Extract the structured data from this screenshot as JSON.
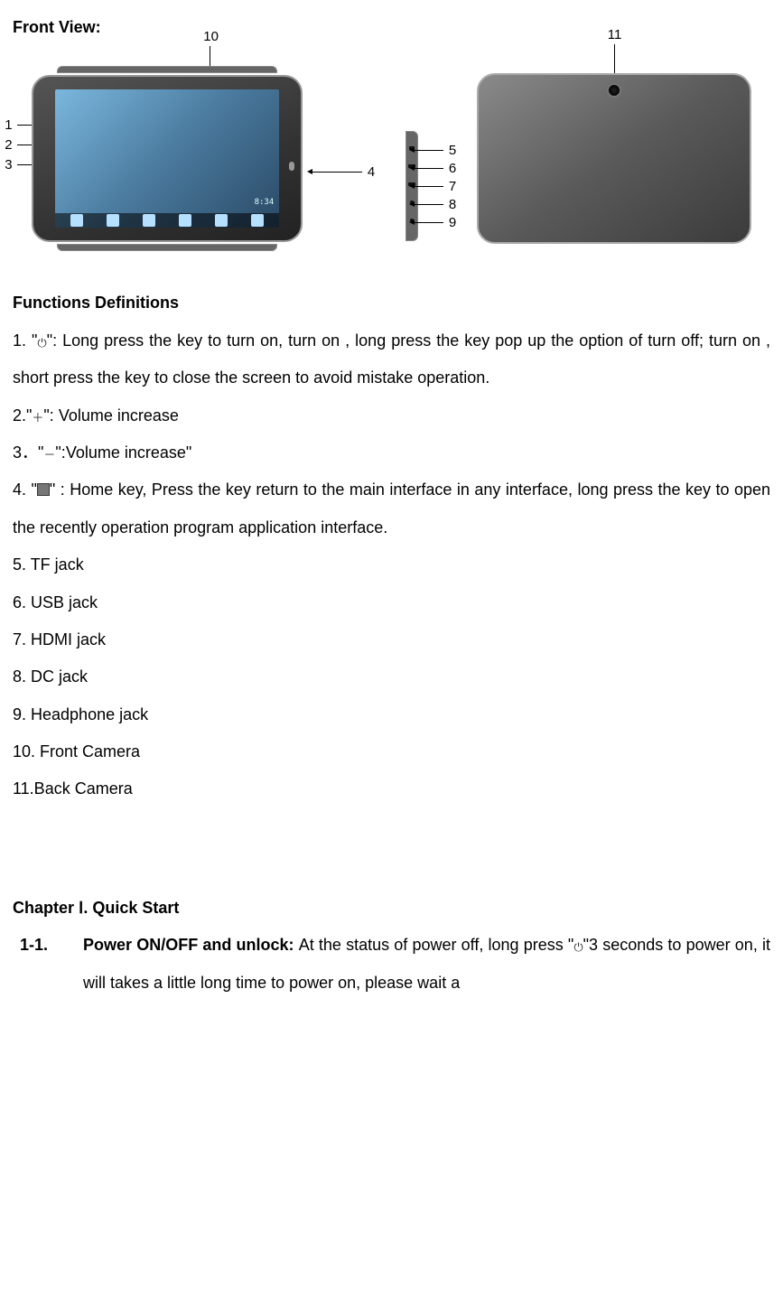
{
  "title": "Front View:",
  "diagram": {
    "front": {
      "leftCallouts": [
        "1",
        "2",
        "3"
      ],
      "rightCallout": "4",
      "topCallout": "10",
      "screenClock": "8:34",
      "topRightCallouts": [
        "5",
        "6",
        "7",
        "8",
        "9"
      ]
    },
    "back": {
      "topCallout": "11"
    }
  },
  "functionsHeader": "Functions Definitions",
  "functions": [
    "1. \"⏻\": Long press the key to turn on, turn on , long press the key pop up the option of turn off; turn on , short press the key to close the screen to avoid mistake operation.",
    "2.\"＋\": Volume increase",
    "3．\"－\":Volume increase\"",
    "4. \"▢\" : Home key, Press the key return to the main interface in any interface, long press the key to open the recently operation program application interface.",
    "5. TF jack",
    "6. USB jack",
    "7. HDMI jack",
    "8. DC jack",
    "9. Headphone jack",
    "10. Front Camera",
    "11.Back Camera"
  ],
  "chapter": {
    "header": "Chapter Ⅰ. Quick Start",
    "item": {
      "num": "1-1.",
      "boldLead": "Power ON/OFF and unlock: ",
      "body": "At the status of power off, long press \"⏻\"3 seconds to power on, it will takes a little long time to power on, please wait a"
    }
  }
}
